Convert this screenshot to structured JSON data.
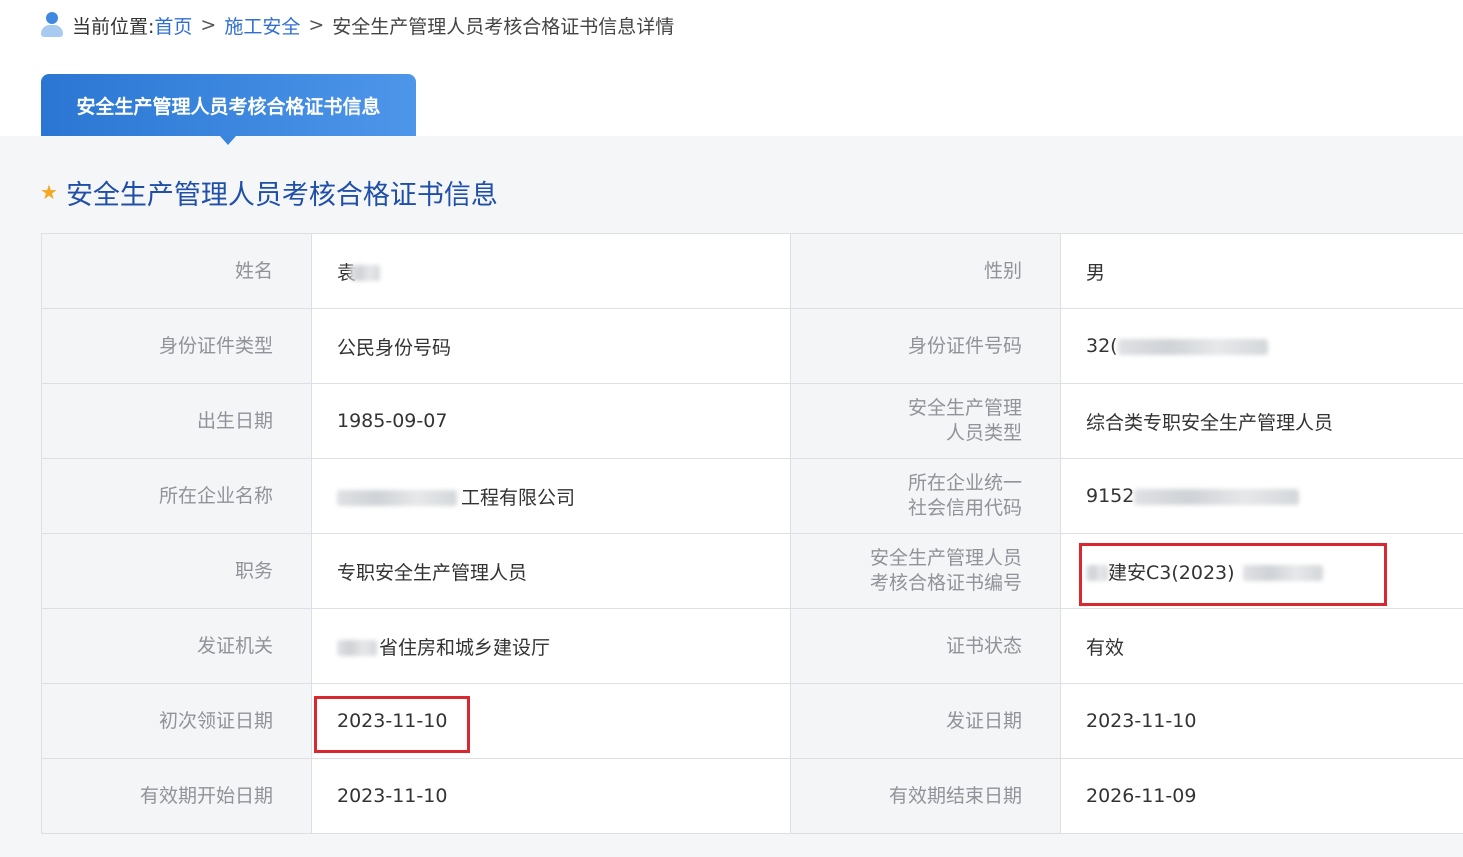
{
  "breadcrumb": {
    "prefix": "当前位置:",
    "home": "首页",
    "sep": ">",
    "category": "施工安全",
    "current": "安全生产管理人员考核合格证书信息详情"
  },
  "tab": {
    "label": "安全生产管理人员考核合格证书信息"
  },
  "section": {
    "title": "安全生产管理人员考核合格证书信息"
  },
  "fields": {
    "name": {
      "label": "姓名",
      "value": "袁"
    },
    "gender": {
      "label": "性别",
      "value": "男"
    },
    "id_type": {
      "label": "身份证件类型",
      "value": "公民身份号码"
    },
    "id_number": {
      "label": "身份证件号码",
      "value": "32("
    },
    "birth_date": {
      "label": "出生日期",
      "value": "1985-09-07"
    },
    "personnel_type": {
      "label_line1": "安全生产管理",
      "label_line2": "人员类型",
      "value": "综合类专职安全生产管理人员"
    },
    "company_name": {
      "label": "所在企业名称",
      "value": "工程有限公司"
    },
    "credit_code": {
      "label_line1": "所在企业统一",
      "label_line2": "社会信用代码",
      "value": "9152"
    },
    "position": {
      "label": "职务",
      "value": "专职安全生产管理人员"
    },
    "cert_number": {
      "label_line1": "安全生产管理人员",
      "label_line2": "考核合格证书编号",
      "value": "建安C3(2023)"
    },
    "issuing_authority": {
      "label": "发证机关",
      "value": "省住房和城乡建设厅"
    },
    "cert_status": {
      "label": "证书状态",
      "value": "有效"
    },
    "first_issue_date": {
      "label": "初次领证日期",
      "value": "2023-11-10"
    },
    "issue_date": {
      "label": "发证日期",
      "value": "2023-11-10"
    },
    "valid_start": {
      "label": "有效期开始日期",
      "value": "2023-11-10"
    },
    "valid_end": {
      "label": "有效期结束日期",
      "value": "2026-11-09"
    }
  }
}
